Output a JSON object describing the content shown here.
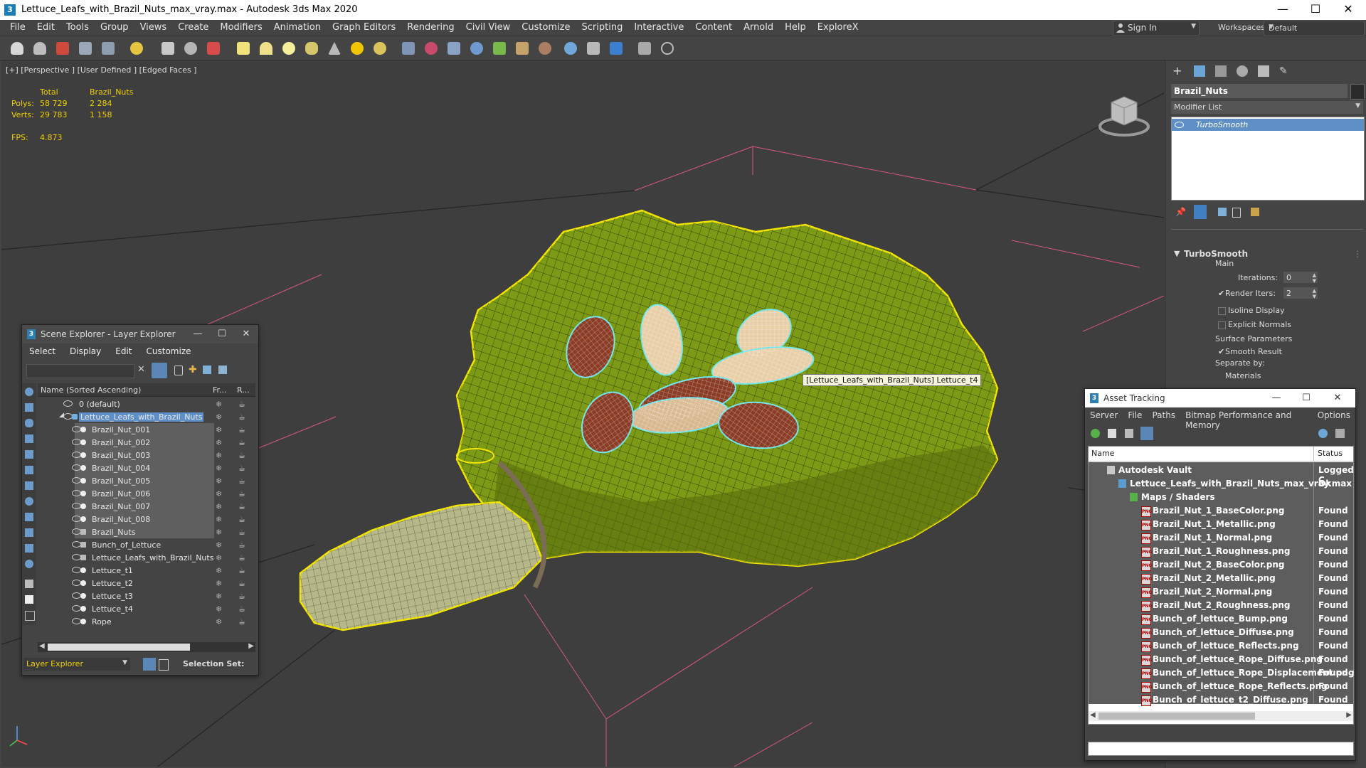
{
  "window": {
    "title": "Lettuce_Leafs_with_Brazil_Nuts_max_vray.max - Autodesk 3ds Max 2020",
    "minimize": "—",
    "maximize": "☐",
    "close": "✕"
  },
  "menubar": {
    "items": [
      "File",
      "Edit",
      "Tools",
      "Group",
      "Views",
      "Create",
      "Modifiers",
      "Animation",
      "Graph Editors",
      "Rendering",
      "Civil View",
      "Customize",
      "Scripting",
      "Interactive",
      "Content",
      "Arnold",
      "Help",
      "ExploreX"
    ],
    "sign_in": "Sign In",
    "workspaces_label": "Workspaces:",
    "workspace_value": "Default"
  },
  "toolbar": {
    "icons": [
      "undo-icon",
      "redo-icon",
      "select-link-icon",
      "unlink-icon",
      "bind-spacewarp-icon",
      "select-filter-icon",
      "select-object-icon",
      "select-by-name-icon",
      "rect-region-icon",
      "move-icon",
      "rotate-icon",
      "scale-icon",
      "box-icon",
      "sphere-icon",
      "cylinder-icon",
      "teapot-icon",
      "cone-icon",
      "light-icon",
      "camera-icon",
      "particle-icon",
      "helper-icon",
      "spacewarp-icon",
      "systems-icon",
      "foliage-icon",
      "hair-icon",
      "material-icon",
      "render-setup-icon",
      "render-frame-icon",
      "render-icon",
      "render-cloud-icon",
      "help-icon"
    ]
  },
  "viewport": {
    "label": "[+] [Perspective ] [User Defined ] [Edged Faces ]",
    "stats": {
      "col_total": "Total",
      "col_selected": "Brazil_Nuts",
      "polys_label": "Polys:",
      "polys_total": "58 729",
      "polys_selected": "2 284",
      "verts_label": "Verts:",
      "verts_total": "29 783",
      "verts_selected": "1 158",
      "fps_label": "FPS:",
      "fps_value": "4.873"
    },
    "tooltip": "[Lettuce_Leafs_with_Brazil_Nuts] Lettuce_t4"
  },
  "scene_explorer": {
    "title": "Scene Explorer - Layer Explorer",
    "menu": [
      "Select",
      "Display",
      "Edit",
      "Customize"
    ],
    "col_name": "Name (Sorted Ascending)",
    "col_fr": "Fr...",
    "col_r": "R...",
    "rows": [
      {
        "name": "0 (default)"
      },
      {
        "name": "Lettuce_Leafs_with_Brazil_Nuts"
      },
      {
        "name": "Brazil_Nut_001"
      },
      {
        "name": "Brazil_Nut_002"
      },
      {
        "name": "Brazil_Nut_003"
      },
      {
        "name": "Brazil_Nut_004"
      },
      {
        "name": "Brazil_Nut_005"
      },
      {
        "name": "Brazil_Nut_006"
      },
      {
        "name": "Brazil_Nut_007"
      },
      {
        "name": "Brazil_Nut_008"
      },
      {
        "name": "Brazil_Nuts"
      },
      {
        "name": "Bunch_of_Lettuce"
      },
      {
        "name": "Lettuce_Leafs_with_Brazil_Nuts"
      },
      {
        "name": "Lettuce_t1"
      },
      {
        "name": "Lettuce_t2"
      },
      {
        "name": "Lettuce_t3"
      },
      {
        "name": "Lettuce_t4"
      },
      {
        "name": "Rope"
      }
    ],
    "footer_explorer": "Layer Explorer",
    "footer_selection": "Selection Set:"
  },
  "command_panel": {
    "object_name": "Brazil_Nuts",
    "modifier_list": "Modifier List",
    "stack_item": "TurboSmooth",
    "rollout_title": "TurboSmooth",
    "main_label": "Main",
    "iterations_label": "Iterations:",
    "iterations_value": "0",
    "render_iters_label": "Render Iters:",
    "render_iters_value": "2",
    "isoline_label": "Isoline Display",
    "explicit_normals_label": "Explicit Normals",
    "surface_params_label": "Surface Parameters",
    "smooth_result_label": "Smooth Result",
    "separate_by_label": "Separate by:",
    "materials_label": "Materials"
  },
  "asset_tracking": {
    "title": "Asset Tracking",
    "menu": [
      "Server",
      "File",
      "Paths",
      "Bitmap Performance and Memory",
      "Options"
    ],
    "col_name": "Name",
    "col_status": "Status",
    "vault": {
      "name": "Autodesk Vault",
      "status": "Logged C"
    },
    "file": {
      "name": "Lettuce_Leafs_with_Brazil_Nuts_max_vray.max",
      "status": "Ok"
    },
    "maps_group": "Maps / Shaders",
    "maps": [
      {
        "name": "Brazil_Nut_1_BaseColor.png",
        "status": "Found"
      },
      {
        "name": "Brazil_Nut_1_Metallic.png",
        "status": "Found"
      },
      {
        "name": "Brazil_Nut_1_Normal.png",
        "status": "Found"
      },
      {
        "name": "Brazil_Nut_1_Roughness.png",
        "status": "Found"
      },
      {
        "name": "Brazil_Nut_2_BaseColor.png",
        "status": "Found"
      },
      {
        "name": "Brazil_Nut_2_Metallic.png",
        "status": "Found"
      },
      {
        "name": "Brazil_Nut_2_Normal.png",
        "status": "Found"
      },
      {
        "name": "Brazil_Nut_2_Roughness.png",
        "status": "Found"
      },
      {
        "name": "Bunch_of_lettuce_Bump.png",
        "status": "Found"
      },
      {
        "name": "Bunch_of_lettuce_Diffuse.png",
        "status": "Found"
      },
      {
        "name": "Bunch_of_lettuce_Reflects.png",
        "status": "Found"
      },
      {
        "name": "Bunch_of_lettuce_Rope_Diffuse.png",
        "status": "Found"
      },
      {
        "name": "Bunch_of_lettuce_Rope_Displacement.png",
        "status": "Found"
      },
      {
        "name": "Bunch_of_lettuce_Rope_Reflects.png",
        "status": "Found"
      },
      {
        "name": "Bunch_of_lettuce_t2_Diffuse.png",
        "status": "Found"
      }
    ]
  },
  "colors": {
    "accent": "#2d7fb1",
    "selection_outline": "#f2e600",
    "nut_outline": "#6fe6ec",
    "lettuce": "#7d9a17",
    "grid_lines": "#e85a8c"
  }
}
